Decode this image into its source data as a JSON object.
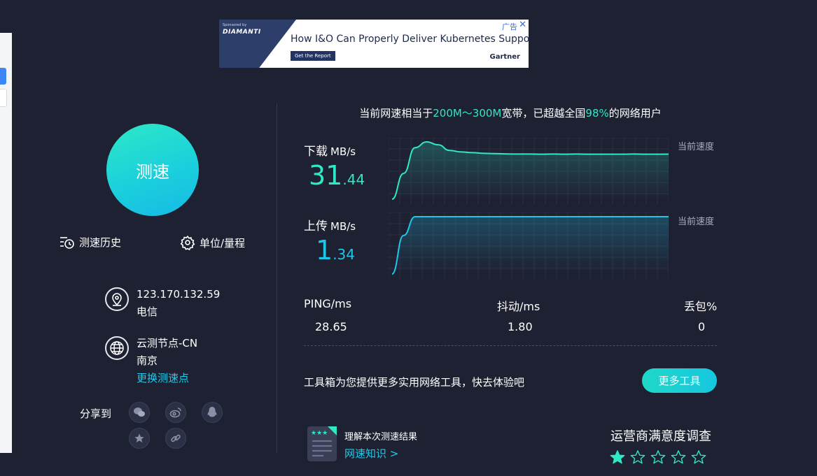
{
  "ad": {
    "sponsor_text": "Sponsored by",
    "brand": "DIAMANTI",
    "headline": "How I&O Can Properly Deliver Kubernetes Support",
    "cta": "Get the Report",
    "partner": "Gartner",
    "ad_label": "广告",
    "close": "✕"
  },
  "test": {
    "button_label": "测速"
  },
  "options": {
    "history": "测速历史",
    "units": "单位/量程"
  },
  "client": {
    "ip": "123.170.132.59",
    "isp": "电信"
  },
  "node": {
    "name": "云测节点-CN",
    "city": "南京",
    "change_link": "更换测速点"
  },
  "share": {
    "label": "分享到"
  },
  "summary": {
    "prefix": "当前网速相当于",
    "bandwidth": "200M～300M",
    "middle": "宽带，已超越全国",
    "percent": "98%",
    "suffix": "的网络用户"
  },
  "download": {
    "label": "下载",
    "unit": "MB/s",
    "int": "31",
    "frac": ".44",
    "current_label": "当前速度",
    "color": "#2ee8c6"
  },
  "upload": {
    "label": "上传",
    "unit": "MB/s",
    "int": "1",
    "frac": ".34",
    "current_label": "当前速度",
    "color": "#1fc6e8"
  },
  "stats": {
    "ping_label": "PING/ms",
    "ping_value": "28.65",
    "jitter_label": "抖动/ms",
    "jitter_value": "1.80",
    "loss_label": "丢包%",
    "loss_value": "0"
  },
  "toolbox": {
    "text": "工具箱为您提供更多实用网络工具，快去体验吧",
    "button": "更多工具"
  },
  "knowledge": {
    "title": "理解本次测速结果",
    "link": "网速知识 >"
  },
  "survey": {
    "title": "运营商满意度调查",
    "rating": 1,
    "max": 5
  },
  "chart_data": [
    {
      "type": "line",
      "title": "下载",
      "ylabel": "MB/s",
      "current": 31.44,
      "series": [
        {
          "name": "下载",
          "values": [
            0,
            18,
            36,
            40,
            38,
            34,
            33,
            32.5,
            32,
            31.8,
            31.6,
            31.5,
            31.5,
            31.4,
            31.5,
            31.4,
            31.5,
            31.4,
            31.4,
            31.4,
            31.4,
            31.5,
            31.4,
            31.4,
            31.44
          ]
        }
      ]
    },
    {
      "type": "line",
      "title": "上传",
      "ylabel": "MB/s",
      "current": 1.34,
      "series": [
        {
          "name": "上传",
          "values": [
            0,
            0.9,
            1.34,
            1.34,
            1.34,
            1.34,
            1.34,
            1.34,
            1.34,
            1.34,
            1.34,
            1.34,
            1.34,
            1.34,
            1.34,
            1.34,
            1.34,
            1.34,
            1.34,
            1.34,
            1.34,
            1.34,
            1.34,
            1.34,
            1.34
          ]
        }
      ]
    }
  ]
}
